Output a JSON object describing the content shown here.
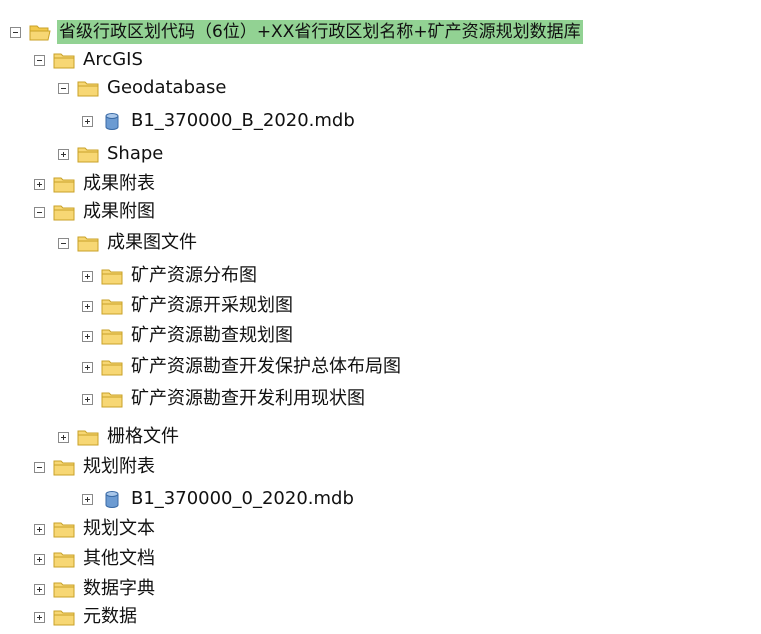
{
  "tree": {
    "root": {
      "label": "省级行政区划代码（6位）+XX省行政区划名称+矿产资源规划数据库",
      "state": "expanded",
      "icon": "folder-open-icon",
      "selected": true
    },
    "items": [
      {
        "label": "ArcGIS",
        "state": "expanded",
        "icon": "folder-icon"
      },
      {
        "label": "Geodatabase",
        "state": "expanded",
        "icon": "folder-icon"
      },
      {
        "label": "B1_370000_B_2020.mdb",
        "state": "collapsed",
        "icon": "database-icon"
      },
      {
        "label": "Shape",
        "state": "collapsed",
        "icon": "folder-icon"
      },
      {
        "label": "成果附表",
        "state": "collapsed",
        "icon": "folder-icon"
      },
      {
        "label": "成果附图",
        "state": "expanded",
        "icon": "folder-icon"
      },
      {
        "label": "成果图文件",
        "state": "expanded",
        "icon": "folder-icon"
      },
      {
        "label": "矿产资源分布图",
        "state": "collapsed",
        "icon": "folder-icon"
      },
      {
        "label": "矿产资源开采规划图",
        "state": "collapsed",
        "icon": "folder-icon"
      },
      {
        "label": "矿产资源勘查规划图",
        "state": "collapsed",
        "icon": "folder-icon"
      },
      {
        "label": "矿产资源勘查开发保护总体布局图",
        "state": "collapsed",
        "icon": "folder-icon"
      },
      {
        "label": "矿产资源勘查开发利用现状图",
        "state": "collapsed",
        "icon": "folder-icon"
      },
      {
        "label": "栅格文件",
        "state": "collapsed",
        "icon": "folder-icon"
      },
      {
        "label": "规划附表",
        "state": "expanded",
        "icon": "folder-icon"
      },
      {
        "label": "B1_370000_0_2020.mdb",
        "state": "collapsed",
        "icon": "database-icon"
      },
      {
        "label": "规划文本",
        "state": "collapsed",
        "icon": "folder-icon"
      },
      {
        "label": "其他文档",
        "state": "collapsed",
        "icon": "folder-icon"
      },
      {
        "label": "数据字典",
        "state": "collapsed",
        "icon": "folder-icon"
      },
      {
        "label": "元数据",
        "state": "collapsed",
        "icon": "folder-icon"
      }
    ]
  },
  "colors": {
    "selection": "#92d293",
    "folder_fill": "#f7d774",
    "folder_stroke": "#c9a227",
    "database_fill": "#6c9bd2"
  }
}
